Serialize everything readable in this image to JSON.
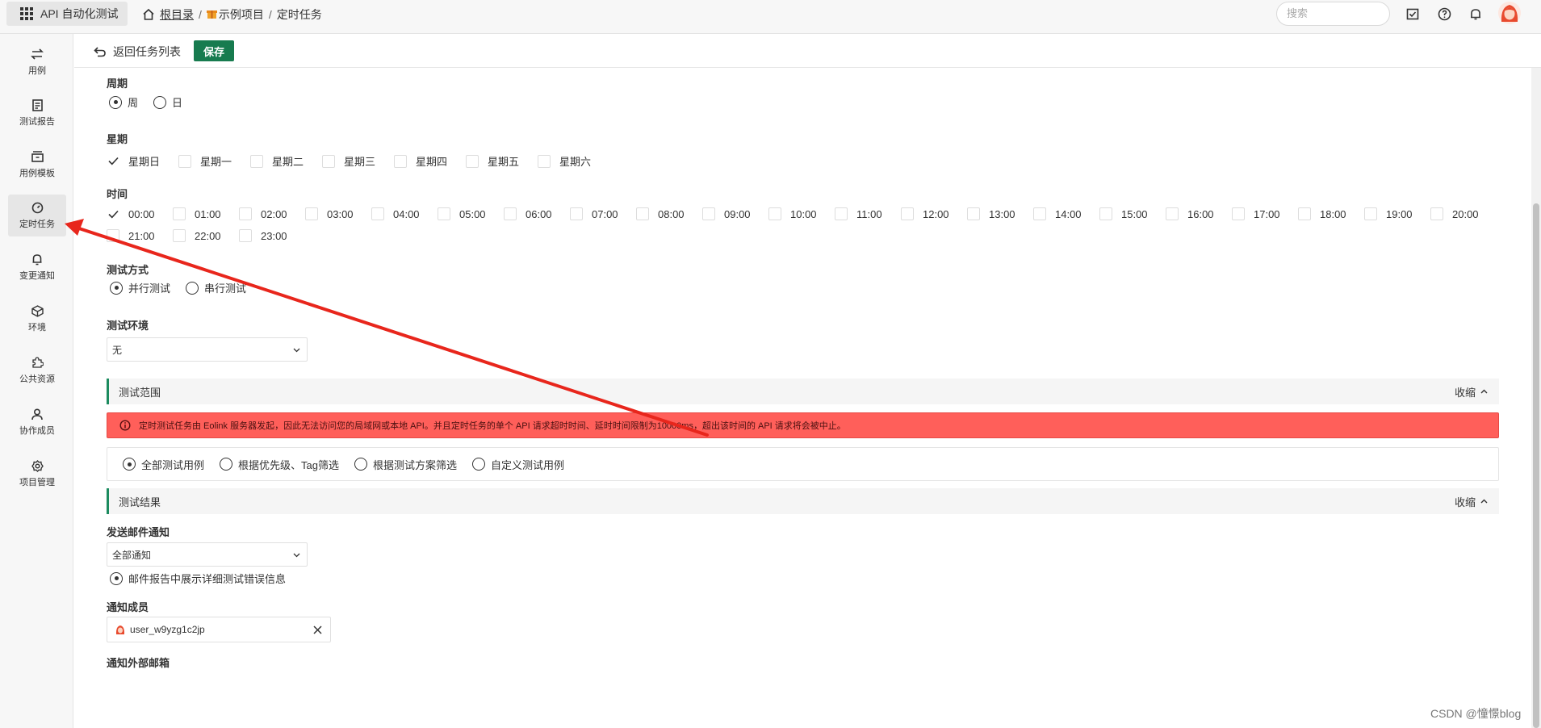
{
  "app": {
    "title": "API 自动化测试"
  },
  "breadcrumb": {
    "root": "根目录",
    "project": "示例项目",
    "current": "定时任务",
    "separator": "/"
  },
  "search": {
    "placeholder": "搜索"
  },
  "sidebar": {
    "items": [
      {
        "label": "用例",
        "icon": "swap-arrows-icon"
      },
      {
        "label": "测试报告",
        "icon": "report-icon"
      },
      {
        "label": "用例模板",
        "icon": "template-icon"
      },
      {
        "label": "定时任务",
        "icon": "timer-icon",
        "active": true
      },
      {
        "label": "变更通知",
        "icon": "bell-icon"
      },
      {
        "label": "环境",
        "icon": "cube-icon"
      },
      {
        "label": "公共资源",
        "icon": "puzzle-icon"
      },
      {
        "label": "协作成员",
        "icon": "user-icon"
      },
      {
        "label": "项目管理",
        "icon": "gear-icon"
      }
    ]
  },
  "toolbar": {
    "back_label": "返回任务列表",
    "save_label": "保存"
  },
  "form": {
    "period": {
      "label": "周期",
      "options": [
        "周",
        "日"
      ],
      "selected": "周"
    },
    "weekday": {
      "label": "星期",
      "options": [
        "星期日",
        "星期一",
        "星期二",
        "星期三",
        "星期四",
        "星期五",
        "星期六"
      ],
      "checked": [
        "星期日"
      ]
    },
    "time": {
      "label": "时间",
      "options": [
        "00:00",
        "01:00",
        "02:00",
        "03:00",
        "04:00",
        "05:00",
        "06:00",
        "07:00",
        "08:00",
        "09:00",
        "10:00",
        "11:00",
        "12:00",
        "13:00",
        "14:00",
        "15:00",
        "16:00",
        "17:00",
        "18:00",
        "19:00",
        "20:00",
        "21:00",
        "22:00",
        "23:00"
      ],
      "checked": [
        "00:00"
      ]
    },
    "test_mode": {
      "label": "测试方式",
      "options": [
        "并行测试",
        "串行测试"
      ],
      "selected": "并行测试"
    },
    "test_env": {
      "label": "测试环境",
      "value": "无"
    },
    "scope_section": {
      "title": "测试范围",
      "collapse_label": "收缩"
    },
    "alert_text": "定时测试任务由 Eolink 服务器发起，因此无法访问您的局域网或本地 API。并且定时任务的单个 API 请求超时时间、延时时间限制为10000ms，超出该时间的 API 请求将会被中止。",
    "scope_options": {
      "options": [
        "全部测试用例",
        "根据优先级、Tag筛选",
        "根据测试方案筛选",
        "自定义测试用例"
      ],
      "selected": "全部测试用例"
    },
    "result_section": {
      "title": "测试结果",
      "collapse_label": "收缩"
    },
    "email_notify": {
      "label": "发送邮件通知",
      "value": "全部通知"
    },
    "email_detail": {
      "label": "邮件报告中展示详细测试错误信息",
      "selected": true
    },
    "notify_members": {
      "label": "通知成员",
      "members": [
        "user_w9yzg1c2jp"
      ]
    },
    "external_email": {
      "label": "通知外部邮箱"
    }
  },
  "watermark": "CSDN @憧憬blog",
  "colors": {
    "primary": "#177b4f",
    "section_accent": "#1c8b5f",
    "alert_bg": "#ff5f5a",
    "annotation_arrow": "#e8261c"
  }
}
